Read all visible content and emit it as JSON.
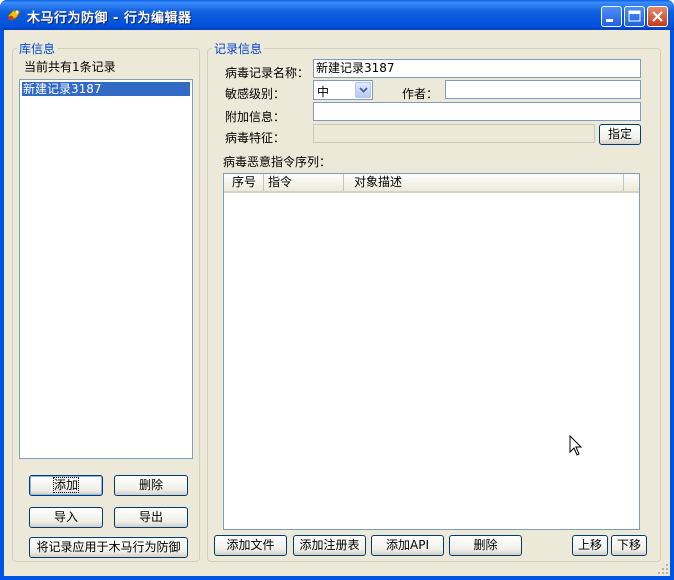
{
  "window": {
    "title": "木马行为防御 - 行为编辑器",
    "icons": {
      "app": "app-icon",
      "minimize": "minimize-icon",
      "maximize": "maximize-icon",
      "close": "close-icon"
    }
  },
  "library": {
    "legend": "库信息",
    "count_text": "当前共有1条记录",
    "items": [
      {
        "label": "新建记录3187",
        "selected": true
      }
    ],
    "buttons": {
      "add": "添加",
      "delete": "删除",
      "import": "导入",
      "export": "导出",
      "apply": "将记录应用于木马行为防御"
    }
  },
  "record": {
    "legend": "记录信息",
    "name_label": "病毒记录名称：",
    "name_value": "新建记录3187",
    "level_label": "敏感级别：",
    "level_value": "中",
    "author_label": "作者：",
    "author_value": "",
    "extra_label": "附加信息：",
    "extra_value": "",
    "signature_label": "病毒特征：",
    "signature_value": "",
    "assign_button": "指定",
    "sequence_label": "病毒恶意指令序列：",
    "columns": [
      "序号",
      "指令",
      "对象描述"
    ],
    "rows": [],
    "buttons": {
      "add_file": "添加文件",
      "add_registry": "添加注册表",
      "add_api": "添加API",
      "delete": "删除",
      "move_up": "上移",
      "move_down": "下移"
    }
  }
}
